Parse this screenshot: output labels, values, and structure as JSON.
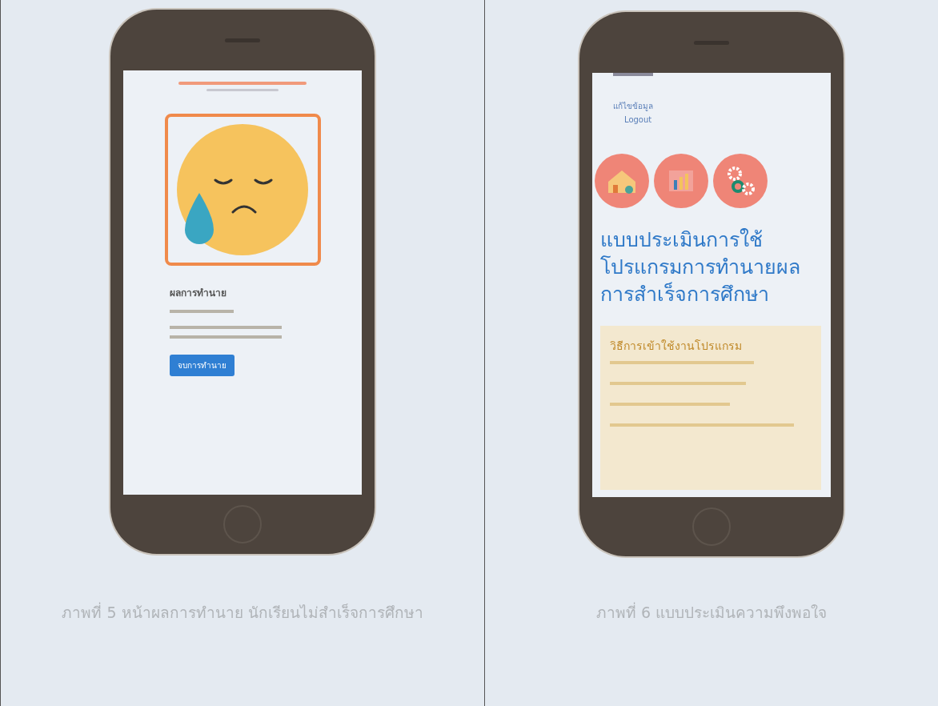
{
  "figures": [
    {
      "kind": "prediction",
      "caption": "ภาพที่ 5 หน้าผลการทำนาย นักเรียนไม่สำเร็จการศึกษา",
      "screen": {
        "heading": "ผลการทำนาย",
        "button": "จบการทำนาย"
      }
    },
    {
      "kind": "survey",
      "caption": "ภาพที่ 6 แบบประเมินความพึงพอใจ",
      "screen": {
        "links": [
          "แก้ไขข้อมูล",
          "Logout"
        ],
        "title_lines": [
          "แบบประเมินการใช้",
          "โปรแกรมการทำนายผล",
          "การสำเร็จการศึกษา"
        ],
        "instructions_title": "วิธีการเข้าใช้งานโปรแกรม"
      }
    }
  ]
}
